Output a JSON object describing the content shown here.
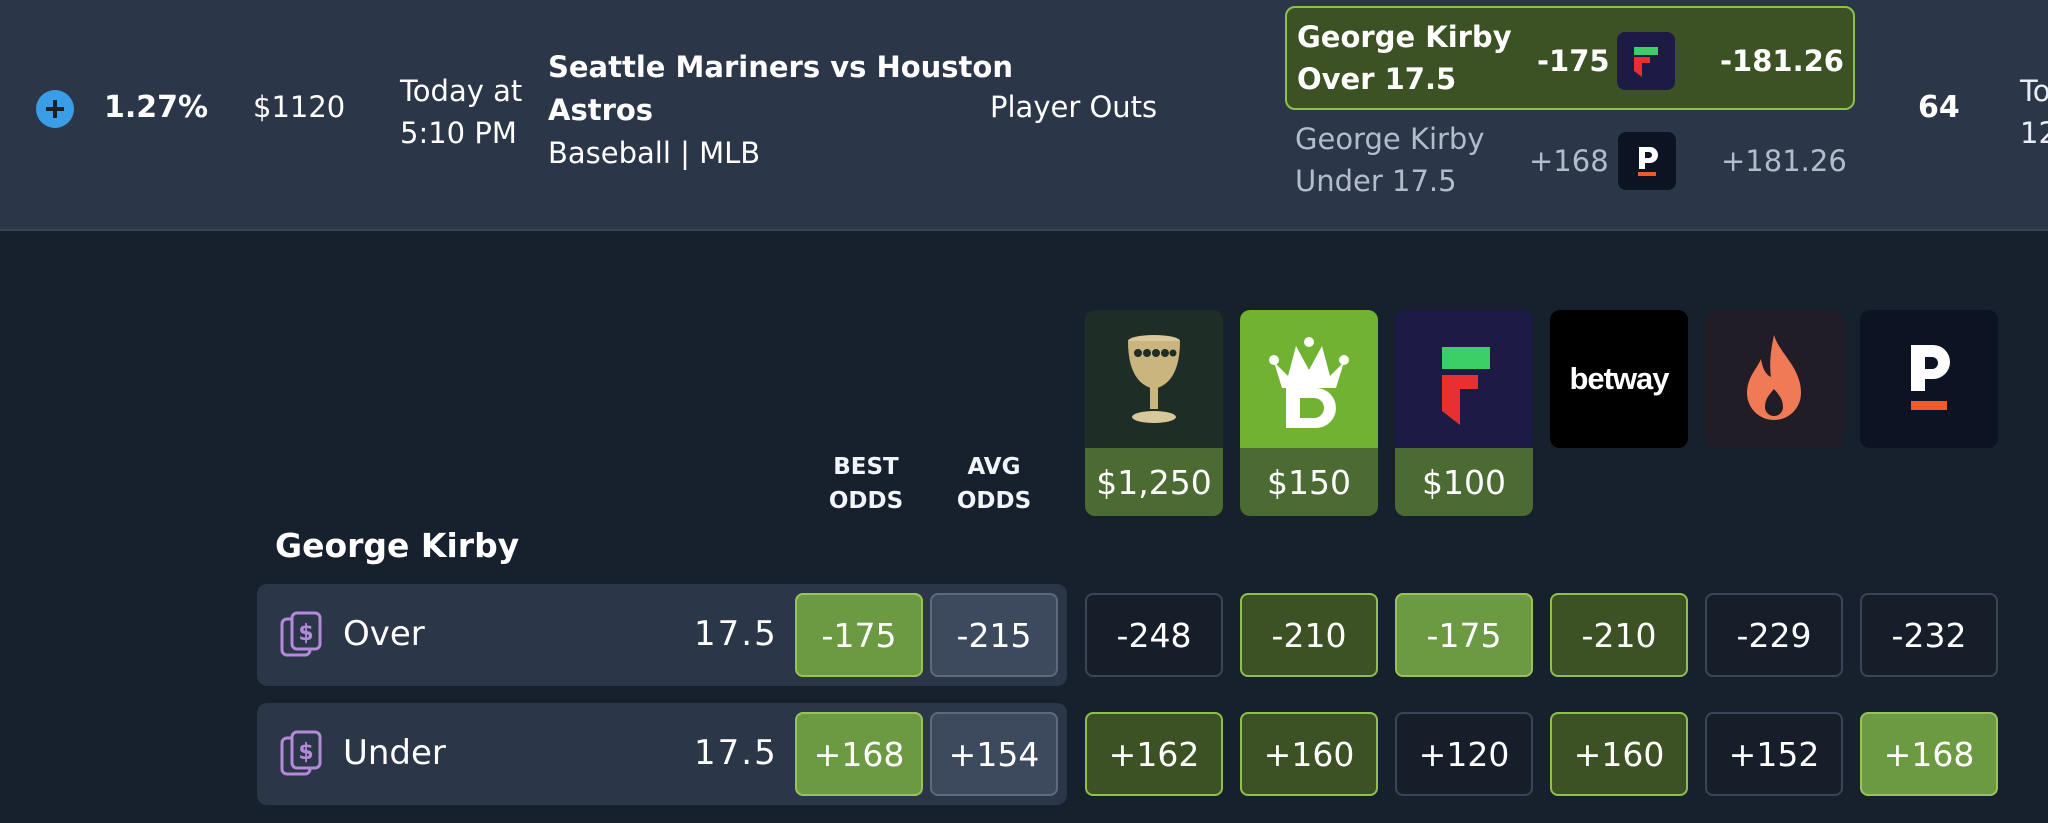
{
  "summary": {
    "ev_percent": "1.27%",
    "stake": "$1120",
    "date_line1": "Today at",
    "date_line2": "5:10 PM",
    "event_line1": "Seattle Mariners vs Houston",
    "event_line2": "Astros",
    "league": "Baseball | MLB",
    "market": "Player Outs",
    "count": "64",
    "cut_line1": "To",
    "cut_line2": "12",
    "best_bet": {
      "name_line1": "George Kirby",
      "name_line2": "Over 17.5",
      "odds": "-175",
      "book_icon": "fanatics-logo",
      "fair": "-181.26"
    },
    "other_bet": {
      "name_line1": "George Kirby",
      "name_line2": "Under 17.5",
      "odds": "+168",
      "book_icon": "prizepicks-logo",
      "fair": "+181.26"
    }
  },
  "headers": {
    "best_line1": "BEST",
    "best_line2": "ODDS",
    "avg_line1": "AVG",
    "avg_line2": "ODDS"
  },
  "books": [
    {
      "icon": "trophy-cup-logo",
      "bonus": "$1,250"
    },
    {
      "icon": "draftkings-logo",
      "bonus": "$150"
    },
    {
      "icon": "fanatics-logo",
      "bonus": "$100"
    },
    {
      "icon": "betway-logo",
      "wordmark": "betway",
      "bonus": ""
    },
    {
      "icon": "flame-logo",
      "bonus": ""
    },
    {
      "icon": "prizepicks-logo",
      "bonus": ""
    }
  ],
  "player": "George Kirby",
  "rows": [
    {
      "icon": "dollar-cards-icon",
      "label": "Over",
      "line": "17.5",
      "best": "-175",
      "avg": "-215",
      "odds": [
        "-248",
        "-210",
        "-175",
        "-210",
        "-229",
        "-232"
      ]
    },
    {
      "icon": "dollar-cards-icon",
      "label": "Under",
      "line": "17.5",
      "best": "+168",
      "avg": "+154",
      "odds": [
        "+162",
        "+160",
        "+120",
        "+160",
        "+152",
        "+168"
      ]
    }
  ],
  "colors": {
    "bg": "#17202d",
    "panel": "#2b3649",
    "best_green": "#6b9a42",
    "good_green": "#3c5224",
    "accent_blue": "#3a9ee6"
  }
}
